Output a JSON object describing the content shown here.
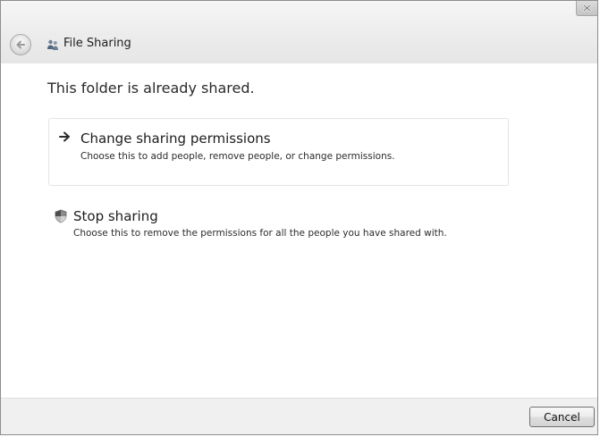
{
  "window": {
    "title": "File Sharing",
    "close_label": "×"
  },
  "main": {
    "heading": "This folder is already shared.",
    "options": [
      {
        "title": "Change sharing permissions",
        "description": "Choose this to add people, remove people, or change permissions.",
        "icon": "arrow-right-icon"
      },
      {
        "title": "Stop sharing",
        "description": "Choose this to remove the permissions for all the people you have shared with.",
        "icon": "shield-icon"
      }
    ]
  },
  "footer": {
    "cancel_label": "Cancel"
  },
  "icons": {
    "back": "back-arrow-icon",
    "title": "people-icon",
    "close": "close-icon"
  },
  "colors": {
    "titlebar": "#ececec",
    "footer": "#f0f0f0",
    "text": "#1d1d1d"
  }
}
